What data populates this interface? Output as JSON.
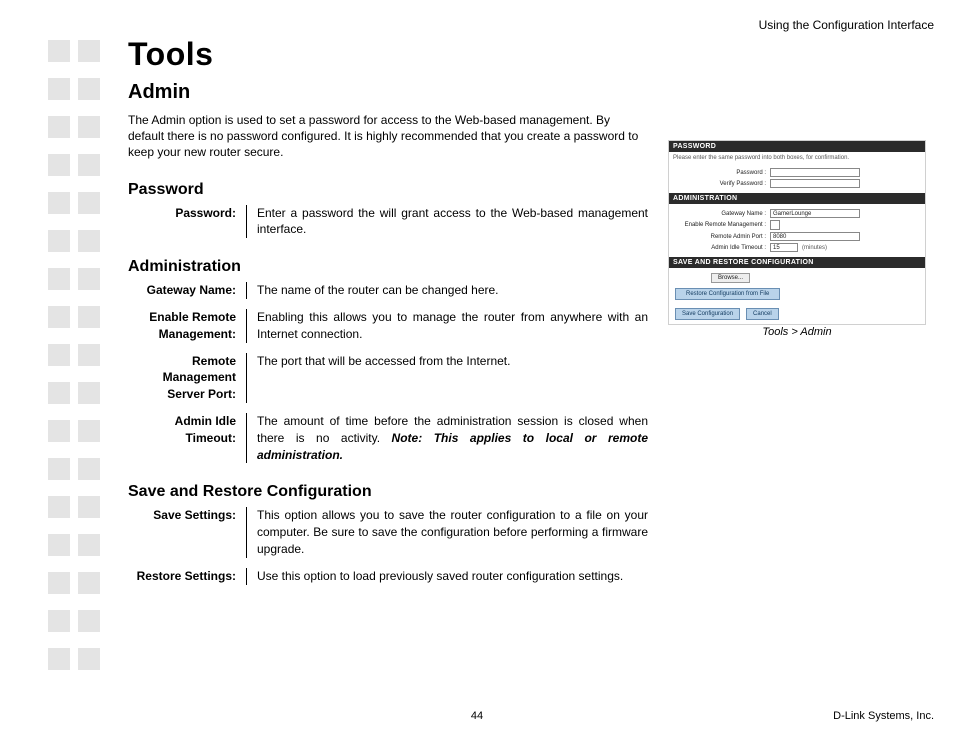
{
  "header": {
    "right": "Using the Configuration Interface"
  },
  "title": "Tools",
  "subtitle": "Admin",
  "intro": "The Admin option is used to set a password for access to the Web-based management. By default there is no password configured. It is highly recommended that you create a password to keep your new router secure.",
  "sections": {
    "password": {
      "heading": "Password",
      "rows": [
        {
          "term": "Password:",
          "desc": "Enter a password the will grant access to the Web-based management interface."
        }
      ]
    },
    "administration": {
      "heading": "Administration",
      "rows": [
        {
          "term": "Gateway Name:",
          "desc": "The name of the router can be changed here."
        },
        {
          "term": "Enable Remote Management:",
          "desc": "Enabling this allows you to manage the router from anywhere with an Internet connection."
        },
        {
          "term": "Remote Management Server Port:",
          "desc": "The port that will be accessed from the Internet."
        },
        {
          "term": "Admin Idle Timeout:",
          "desc": "The amount of time before the administration session is closed when there is no activity. ",
          "note": "Note: This applies to local or remote administration."
        }
      ]
    },
    "saverestore": {
      "heading": "Save and Restore Configuration",
      "rows": [
        {
          "term": "Save Settings:",
          "desc": "This option allows you to save the router configuration to a file on your computer. Be sure to save the configuration before performing a firmware upgrade."
        },
        {
          "term": "Restore Settings:",
          "desc": "Use this option to load previously saved router configuration settings."
        }
      ]
    }
  },
  "inset": {
    "password_hdr": "PASSWORD",
    "password_hint": "Please enter the same password into both boxes, for confirmation.",
    "pw_label": "Password :",
    "pw2_label": "Verify Password :",
    "admin_hdr": "ADMINISTRATION",
    "gw_label": "Gateway Name :",
    "gw_value": "GamerLounge",
    "erm_label": "Enable Remote Management :",
    "port_label": "Remote Admin Port :",
    "port_value": "8080",
    "idle_label": "Admin Idle Timeout :",
    "idle_value": "15",
    "idle_unit": "(minutes)",
    "save_hdr": "SAVE AND RESTORE CONFIGURATION",
    "browse": "Browse...",
    "restore_btn": "Restore Configuration from File",
    "save_btn": "Save Configuration",
    "cancel_btn": "Cancel",
    "caption": "Tools > Admin"
  },
  "footer": {
    "page": "44",
    "brand": "D-Link Systems, Inc."
  }
}
